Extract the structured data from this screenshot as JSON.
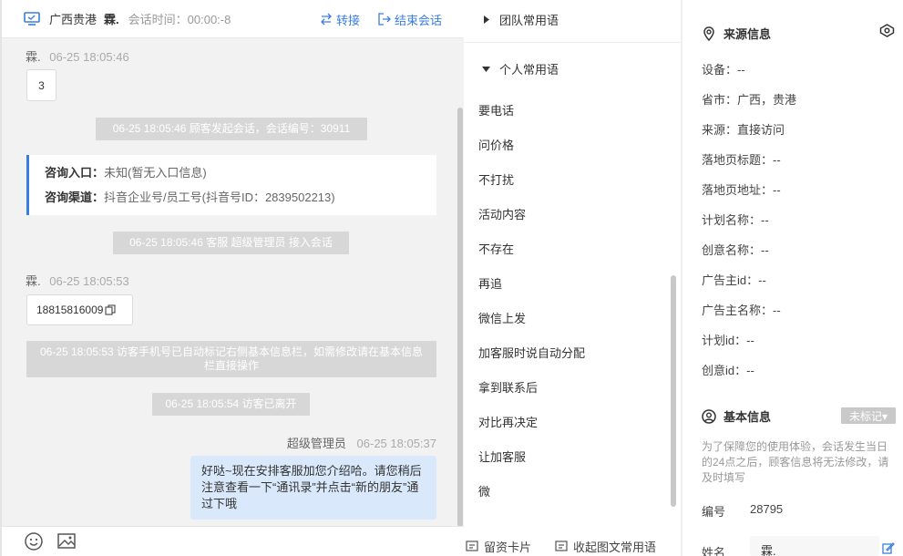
{
  "header": {
    "location": "广西贵港",
    "visitor": "霖.",
    "session_time": "会话时间：00:00:-8",
    "transfer": "转接",
    "end_session": "结束会话"
  },
  "messages": {
    "m1_sender": "霖.",
    "m1_time": "06-25 18:05:46",
    "m1_text": "3",
    "sys1": "06-25 18:05:46 顾客发起会话，会话编号：30911",
    "consult_entry_label": "咨询入口：",
    "consult_entry_value": "未知(暂无入口信息)",
    "consult_channel_label": "咨询渠道：",
    "consult_channel_value": "抖音企业号/员工号(抖音号ID：2839502213)",
    "sys2": "06-25 18:05:46 客服 超级管理员 接入会话",
    "m2_sender": "霖.",
    "m2_time": "06-25 18:05:53",
    "m2_text": "18815816009",
    "sys3": "06-25 18:05:53 访客手机号已自动标记右侧基本信息栏，如需修改请在基本信息栏直接操作",
    "sys4": "06-25 18:05:54 访客已离开",
    "m3_sender": "超级管理员",
    "m3_time": "06-25 18:05:37",
    "m3_text": "好哒~现在安排客服加您介绍哈。请您稍后注意查看一下“通讯录”并点击“新的朋友”通过下哦"
  },
  "phrases": {
    "team_group": "团队常用语",
    "personal_group": "个人常用语",
    "items": [
      "要电话",
      "问价格",
      "不打扰",
      "活动内容",
      "不存在",
      "再追",
      "微信上发",
      "加客服时说自动分配",
      "拿到联系后",
      "对比再决定",
      "让加客服",
      "微"
    ],
    "card_btn": "留资卡片",
    "collapse_btn": "收起图文常用语"
  },
  "source": {
    "title": "来源信息",
    "device": "设备：--",
    "province": "省市：广西，贵港",
    "origin": "来源：直接访问",
    "landing_title": "落地页标题：--",
    "landing_url": "落地页地址：--",
    "plan_name": "计划名称：--",
    "creative_name": "创意名称：--",
    "advertiser_id": "广告主id：--",
    "advertiser_name": "广告主名称：--",
    "plan_id": "计划id：--",
    "creative_id": "创意id：--"
  },
  "basic": {
    "title": "基本信息",
    "tag": "未标记▾",
    "notice": "为了保障您的使用体验，会话发生当日的24点之后，顾客信息将无法修改，请及时填写",
    "number_label": "编号",
    "number_value": "28795",
    "name_label": "姓名",
    "name_value": "霖."
  }
}
